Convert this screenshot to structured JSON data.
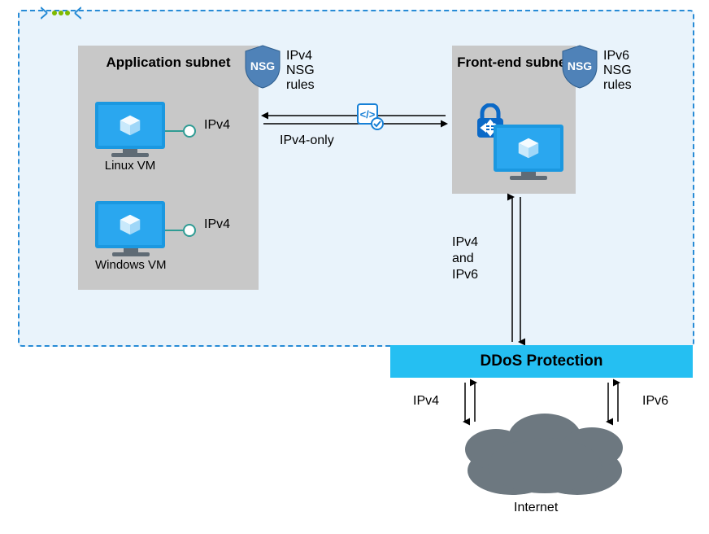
{
  "vnet": {
    "app_subnet": {
      "title": "Application subnet",
      "vms": [
        {
          "label": "Linux VM",
          "nic_label": "IPv4"
        },
        {
          "label": "Windows VM",
          "nic_label": "IPv4"
        }
      ],
      "nsg_label": "IPv4\nNSG\nrules"
    },
    "frontend_subnet": {
      "title": "Front-end subnet",
      "nsg_label": "IPv6\nNSG\nrules"
    },
    "link_label": "IPv4-only"
  },
  "vertical_link_label": "IPv4\nand\nIPv6",
  "ddos_label": "DDoS Protection",
  "internet": {
    "label": "Internet",
    "left_label": "IPv4",
    "right_label": "IPv6"
  }
}
